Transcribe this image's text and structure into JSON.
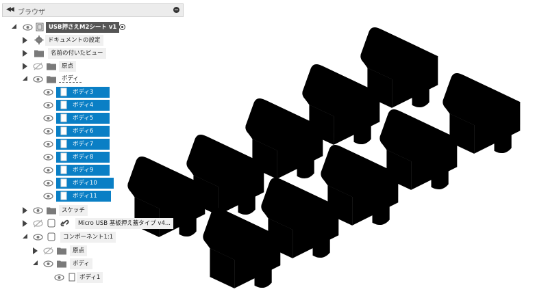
{
  "browser": {
    "title": "ブラウザ",
    "root": "USB押さえM2シート v1",
    "items": [
      {
        "label": "ドキュメントの設定"
      },
      {
        "label": "名前の付いたビュー"
      },
      {
        "label": "原点"
      },
      {
        "label": "ボディ"
      },
      {
        "label": "スケッチ"
      },
      {
        "label": "Micro USB 基板押え蓋タイプ v4..."
      },
      {
        "label": "コンポーネント1:1"
      },
      {
        "label": "原点"
      },
      {
        "label": "ボディ"
      },
      {
        "label": "ボディ1"
      }
    ],
    "bodies": [
      "ボディ3",
      "ボディ4",
      "ボディ5",
      "ボディ6",
      "ボディ7",
      "ボディ8",
      "ボディ9",
      "ボディ10",
      "ボディ11"
    ]
  },
  "colors": {
    "selected": "#0a7fc5",
    "part_blue": "#3f7fe0",
    "part_gray": "#b8b8b8"
  },
  "icons": [
    "collapse-icon",
    "minimize-icon",
    "eye-icon",
    "gear-icon",
    "folder-icon",
    "body-icon",
    "link-icon",
    "component-icon",
    "radio-icon"
  ]
}
